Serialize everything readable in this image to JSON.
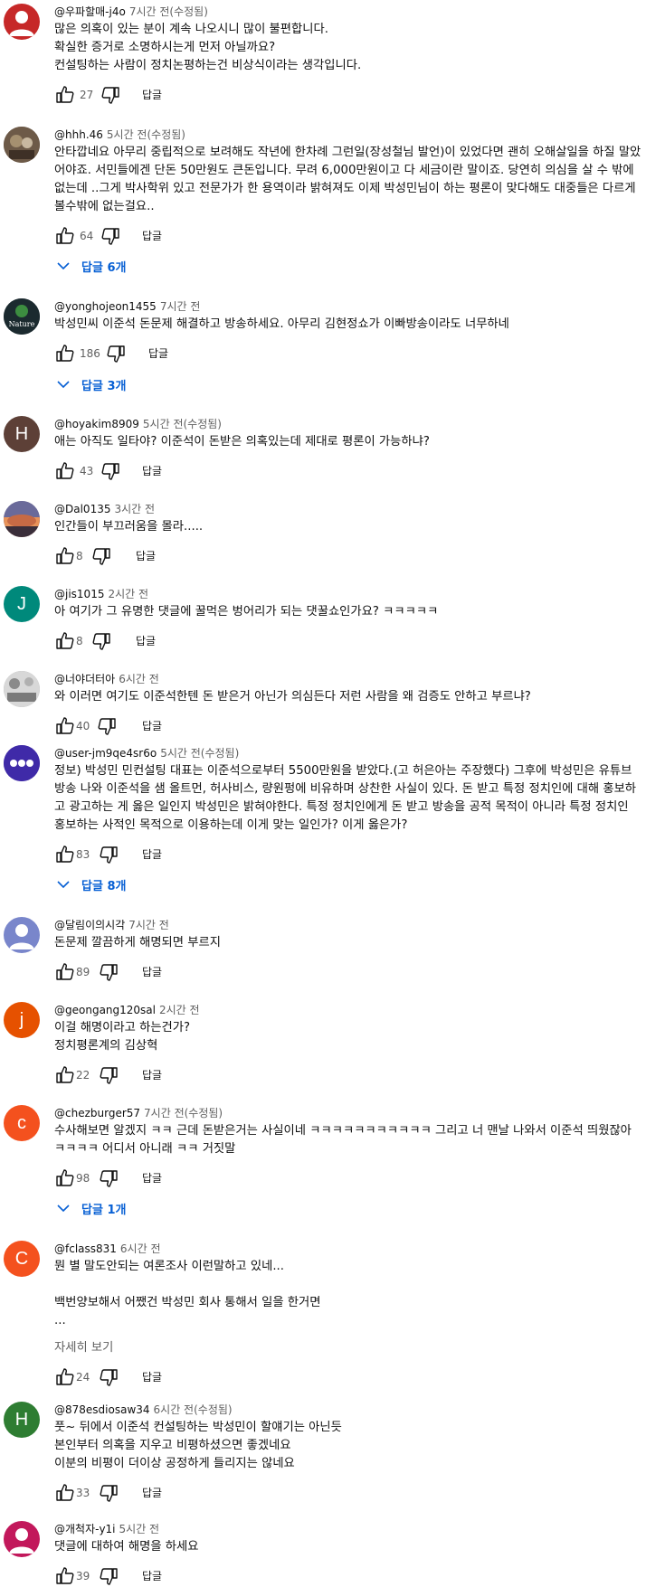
{
  "ui": {
    "reply_label": "답글",
    "read_more": "자세히 보기",
    "edited_suffix": "(수정됨)"
  },
  "colors": {
    "link_blue": "#065fd4",
    "secondary_text": "#606060"
  },
  "comments": [
    {
      "author": "@우파할매-j4o",
      "time": "7시간 전",
      "edited": "(수정됨)",
      "text": "많은 의혹이 있는 분이 계속 나오시니 많이 불편합니다.\n확실한 증거로 소명하시는게 먼저 아닐까요?\n컨설팅하는 사람이 정치논평하는건 비상식이라는 생각입니다.",
      "likes": "27",
      "avatar_color": "#c62828",
      "avatar_icon": "person-icon"
    },
    {
      "author": "@hhh.46",
      "time": "5시간 전",
      "edited": "(수정됨)",
      "text": "안타깝네요 아무리 중립적으로 보려해도 작년에 한차례 그런일(장성철님 발언)이 있었다면 괜히 오해살일을 하질 말았어야죠. 서민들에겐 단돈 50만원도 큰돈입니다. 무려 6,000만원이고 다 세금이란 말이죠. 당연히 의심을 살 수 밖에 없는데 ..그게 박사학위 있고 전문가가 한 용역이라 밝혀져도 이제 박성민님이 하는 평론이 맞다해도 대중들은 다르게 볼수밖에 없는걸요..",
      "likes": "64",
      "replies": "답글 6개",
      "avatar_color": "#5d4a3a",
      "avatar_icon": "photo-icon"
    },
    {
      "author": "@yonghojeon1455",
      "time": "7시간 전",
      "edited": "",
      "text": "박성민씨 이준석 돈문제 해결하고 방송하세요. 아무리 김현정쇼가 이빠방송이라도 너무하네",
      "likes": "186",
      "replies": "답글 3개",
      "avatar_color": "#1b2a2f",
      "avatar_text": "Nature",
      "avatar_icon": "nature-logo-icon"
    },
    {
      "author": "@hoyakim8909",
      "time": "5시간 전",
      "edited": "(수정됨)",
      "text": "애는 아직도 일타야? 이준석이 돈받은 의혹있는데 제대로 평론이 가능하냐?",
      "likes": "43",
      "avatar_color": "#5d4037",
      "avatar_letter": "H"
    },
    {
      "author": "@Dal0135",
      "time": "3시간 전",
      "edited": "",
      "text": "인간들이 부끄러움을 몰라.....",
      "likes": "8",
      "avatar_color": "#7a6a8a",
      "avatar_icon": "sunset-icon"
    },
    {
      "author": "@jis1015",
      "time": "2시간 전",
      "edited": "",
      "text": "아 여기가 그 유명한 댓글에 꿀먹은 벙어리가 되는 댓꿀쇼인가요?  ㅋㅋㅋㅋㅋ",
      "likes": "8",
      "avatar_color": "#00897b",
      "avatar_letter": "J"
    },
    {
      "author": "@너야더터아",
      "time": "6시간 전",
      "edited": "",
      "text": "와 이러면 여기도 이준석한텐 돈 받은거 아닌가 의심든다 저런 사람을 왜 검증도 안하고 부르냐?",
      "likes": "40",
      "avatar_color": "#9e9e9e",
      "avatar_icon": "photo-icon"
    },
    {
      "author": "@user-jm9qe4sr6o",
      "time": "5시간 전",
      "edited": "(수정됨)",
      "text": "정보) 박성민 민컨설팅 대표는 이준석으로부터 5500만원을 받았다.(고 허은아는 주장했다) 그후에 박성민은 유튜브 방송 나와 이준석을 샘 올트먼, 허사비스, 량원펑에 비유하며 상찬한 사실이 있다. 돈 받고 특정 정치인에 대해 홍보하고 광고하는 게 옳은 일인지 박성민은 밝혀야한다. 특정 정치인에게 돈 받고 방송을 공적 목적이 아니라 특정 정치인 홍보하는 사적인 목적으로 이용하는데 이게 맞는 일인가? 이게 옳은가?",
      "likes": "83",
      "replies": "답글 8개",
      "avatar_color": "#3f2aa8",
      "avatar_icon": "dots-icon"
    },
    {
      "author": "@달림이의시각",
      "time": "7시간 전",
      "edited": "",
      "text": "돈문제 깔끔하게 해명되면 부르지",
      "likes": "89",
      "avatar_color": "#7986cb",
      "avatar_icon": "person-icon"
    },
    {
      "author": "@geongang120sal",
      "time": "2시간 전",
      "edited": "",
      "text": "이걸 해명이라고 하는건가?\n정치평론계의 김상혁",
      "likes": "22",
      "avatar_color": "#e65100",
      "avatar_letter": "j"
    },
    {
      "author": "@chezburger57",
      "time": "7시간 전",
      "edited": "(수정됨)",
      "text": "수사해보면 알겠지 ㅋㅋ 근데 돈받은거는 사실이네 ㅋㅋㅋㅋㅋㅋㅋㅋㅋㅋㅋ 그리고 너 맨날 나와서 이준석 띄웠잖아 ㅋㅋㅋㅋ 어디서 아니래 ㅋㅋ 거짓말",
      "likes": "98",
      "replies": "답글 1개",
      "avatar_color": "#f4511e",
      "avatar_letter": "c"
    },
    {
      "author": "@fclass831",
      "time": "6시간 전",
      "edited": "",
      "text": "뭔 별 말도안되는 여론조사 이런말하고 있네...\n\n백번양보해서 어쨌건 박성민 회사 통해서 일을 한거면\n...",
      "likes": "24",
      "read_more": true,
      "avatar_color": "#f4511e",
      "avatar_letter": "C"
    },
    {
      "author": "@878esdiosaw34",
      "time": "6시간 전",
      "edited": "(수정됨)",
      "text": "풋~ 뒤에서 이준석 컨설팅하는 박성민이 할얘기는 아닌듯\n본인부터 의혹을 지우고 비평하셨으면 좋겠네요\n이분의 비평이 더이상 공정하게 들리지는 않네요",
      "likes": "33",
      "avatar_color": "#2e7d32",
      "avatar_letter": "H"
    },
    {
      "author": "@개척자-y1i",
      "time": "5시간 전",
      "edited": "",
      "text": "댓글에 대하여 해명을 하세요",
      "likes": "39",
      "avatar_color": "#c2185b",
      "avatar_icon": "person-icon"
    }
  ]
}
